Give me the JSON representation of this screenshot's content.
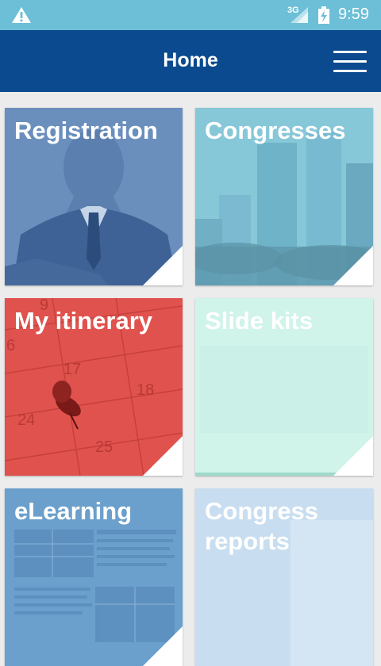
{
  "status_bar": {
    "network": "3G",
    "time": "9:59",
    "icons": [
      "warning-icon",
      "signal-icon",
      "battery-icon"
    ]
  },
  "header": {
    "title": "Home",
    "menu_icon": "hamburger-menu-icon"
  },
  "tiles": [
    {
      "label": "Registration",
      "color": "#6b8fbd"
    },
    {
      "label": "Congresses",
      "color": "#86c7d8"
    },
    {
      "label": "My itinerary",
      "color": "#e0524d"
    },
    {
      "label": "Slide kits",
      "color": "#d3f4ec"
    },
    {
      "label": "eLearning",
      "color": "#6b9fcc"
    },
    {
      "label": "Congress reports",
      "color": "#cbe0ee"
    }
  ],
  "calendar_numbers": [
    "9",
    "17",
    "18",
    "24",
    "25",
    "6"
  ],
  "colors": {
    "status_bar": "#6cbfd6",
    "app_bar": "#0b4a8e",
    "background": "#ececec"
  }
}
